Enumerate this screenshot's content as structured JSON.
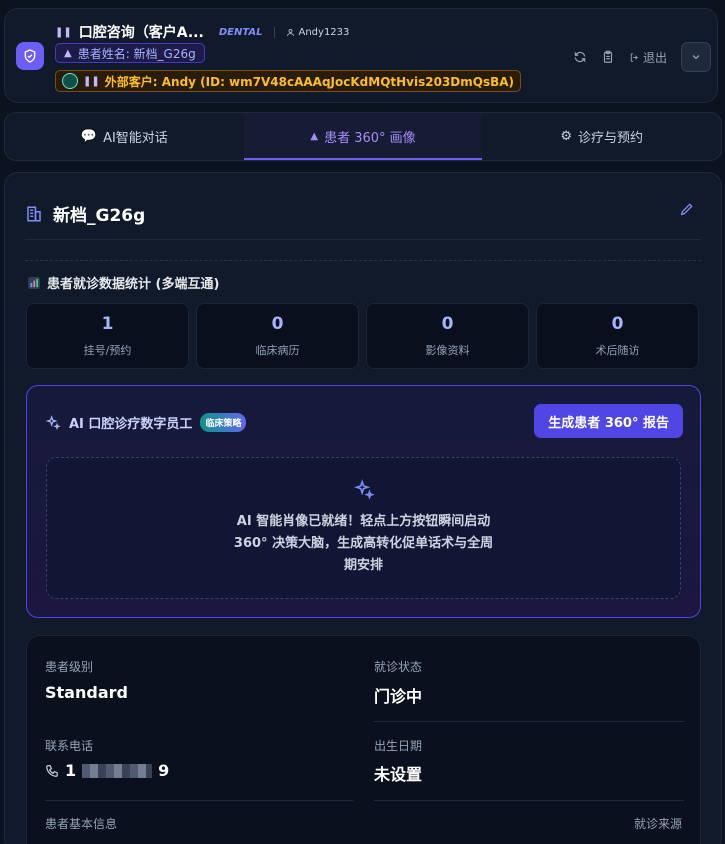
{
  "header": {
    "title": "口腔咨询（客户A...",
    "tag": "DENTAL",
    "user": "Andy1233",
    "patient_pill": "患者姓名: 新档_G26g",
    "external_pill": "外部客户: Andy (ID: wm7V48cAAAqJocKdMQtHvis203DmQsBA)",
    "logout_label": "退出"
  },
  "tabs": [
    {
      "label": "AI智能对话"
    },
    {
      "label": "患者 360° 画像"
    },
    {
      "label": "诊疗与预约"
    }
  ],
  "patient": {
    "name": "新档_G26g"
  },
  "stats": {
    "title": "患者就诊数据统计 (多端互通)",
    "items": [
      {
        "value": "1",
        "label": "挂号/预约"
      },
      {
        "value": "0",
        "label": "临床病历"
      },
      {
        "value": "0",
        "label": "影像资料"
      },
      {
        "value": "0",
        "label": "术后随访"
      }
    ]
  },
  "ai": {
    "title": "AI 口腔诊疗数字员工",
    "badge": "临床策略",
    "button": "生成患者 360° 报告",
    "message": "AI 智能肖像已就绪！轻点上方按钮瞬间启动 360° 决策大脑，生成高转化促单话术与全周期安排"
  },
  "info": {
    "level_label": "患者级别",
    "level_value": "Standard",
    "status_label": "就诊状态",
    "status_value": "门诊中",
    "phone_label": "联系电话",
    "phone_prefix": "1",
    "phone_suffix": "9",
    "birth_label": "出生日期",
    "birth_value": "未设置",
    "basic_label": "患者基本信息",
    "source_label": "就诊来源"
  }
}
